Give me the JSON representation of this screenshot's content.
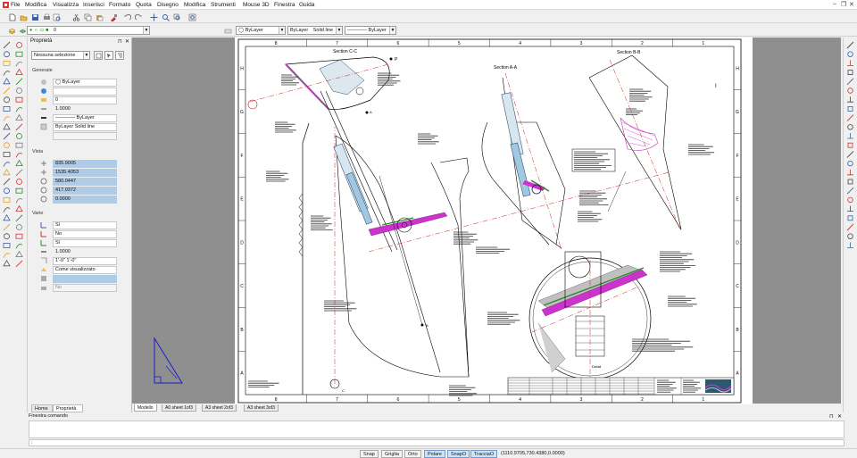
{
  "menu": [
    "File",
    "Modifica",
    "Visualizza",
    "Inserisci",
    "Formato",
    "Quota",
    "Disegno",
    "Modifica",
    "Strumenti",
    "Mouse 3D",
    "Finestra",
    "Guida"
  ],
  "window_controls": {
    "minimize": "–",
    "restore": "❐",
    "close": "✕"
  },
  "layer_toolbar": {
    "layer_value": "0"
  },
  "prop_toolbar": {
    "color": "ByLayer",
    "linetype": "ByLayer",
    "linetype_style": "Solid line",
    "lineweight": "ByLayer"
  },
  "properties": {
    "title": "Proprietà",
    "selection": "Nessuna selezione",
    "sections": {
      "general": "Generale",
      "view": "Vista",
      "misc": "Varie"
    },
    "general": [
      {
        "icon": "color-icon",
        "value": "◯ ByLayer"
      },
      {
        "icon": "layer-icon",
        "value": "0"
      },
      {
        "icon": "linetype-icon",
        "value": "———— ByLayer"
      },
      {
        "icon": "linescale-icon",
        "value": "1.0000"
      },
      {
        "icon": "lineweight-icon",
        "value": "———— ByLayer"
      },
      {
        "icon": "plotstyle-icon",
        "value": "ByLayer    Solid line"
      }
    ],
    "view": [
      "835.9005",
      "1535.4053",
      "580.0447",
      "417.0372",
      "0.0000"
    ],
    "misc": [
      "Sì",
      "No",
      "Sì",
      "1.0000",
      "1'-0\"   1'-0\"",
      "Come visualizzato",
      "",
      "No"
    ],
    "tabs": [
      "Home",
      "Proprietà"
    ]
  },
  "layout_tabs": [
    "Modello",
    "A0 sheet 1of3",
    "A3 sheet 2of3",
    "A3 sheet 3of3"
  ],
  "command": {
    "title": "Finestra comando",
    "prompt": ":"
  },
  "status": {
    "buttons": [
      "Snap",
      "Griglia",
      "Orto",
      "Polare",
      "SnapO",
      "TracciaO"
    ],
    "active": [
      "Polare",
      "SnapO",
      "TracciaO"
    ],
    "coords": "(1110.9705,730.4380,0.0000)"
  },
  "drawing": {
    "col_numbers": [
      "8",
      "7",
      "6",
      "5",
      "4",
      "3",
      "2",
      "1"
    ],
    "row_letters": [
      "H",
      "G",
      "F",
      "E",
      "D",
      "C",
      "B",
      "A"
    ],
    "views": {
      "cc": "Section C-C",
      "aa": "Section A-A",
      "bb": "Section B-B",
      "detail": "Detail"
    },
    "points": [
      "P",
      "C",
      "B",
      "A",
      "I"
    ],
    "accent": "#cc33cc"
  }
}
